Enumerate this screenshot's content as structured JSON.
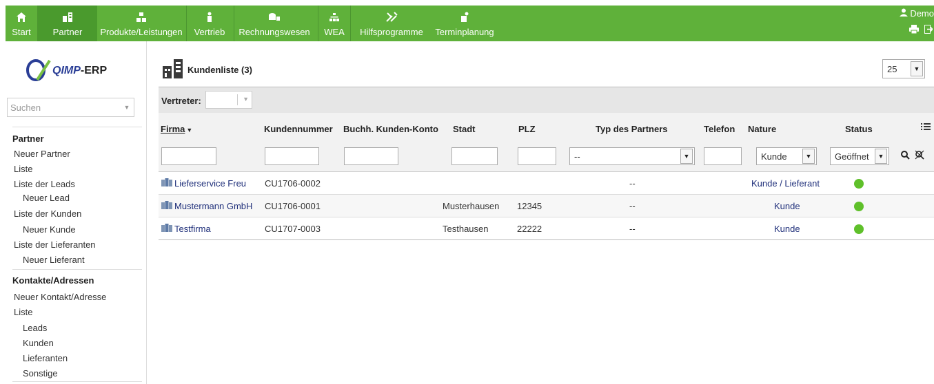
{
  "topbar": {
    "menu": [
      {
        "label": "Start",
        "icon": "home-icon"
      },
      {
        "label": "Partner",
        "icon": "partner-icon",
        "active": true
      },
      {
        "label": "Produkte/Leistungen",
        "icon": "products-icon"
      },
      {
        "label": "Vertrieb",
        "icon": "sales-icon"
      },
      {
        "label": "Rechnungswesen",
        "icon": "accounting-icon"
      },
      {
        "label": "WEA",
        "icon": "wea-icon"
      },
      {
        "label": "Hilfsprogramme",
        "icon": "tools-icon"
      },
      {
        "label": "Terminplanung",
        "icon": "schedule-icon"
      }
    ],
    "user": "Demo",
    "accent": "#5fb13a"
  },
  "sidebar": {
    "logo": {
      "brand": "QIMP",
      "suffix": "-ERP"
    },
    "search_placeholder": "Suchen",
    "section1": {
      "title": "Partner",
      "items": [
        {
          "label": "Neuer Partner",
          "sub": false
        },
        {
          "label": "Liste",
          "sub": false
        },
        {
          "label": "Liste der Leads",
          "sub": false
        },
        {
          "label": "Neuer Lead",
          "sub": true
        },
        {
          "label": "Liste der Kunden",
          "sub": false
        },
        {
          "label": "Neuer Kunde",
          "sub": true
        },
        {
          "label": "Liste der Lieferanten",
          "sub": false
        },
        {
          "label": "Neuer Lieferant",
          "sub": true
        }
      ]
    },
    "section2": {
      "title": "Kontakte/Adressen",
      "items": [
        {
          "label": "Neuer Kontakt/Adresse",
          "sub": false
        },
        {
          "label": "Liste",
          "sub": false
        },
        {
          "label": "Leads",
          "sub": true
        },
        {
          "label": "Kunden",
          "sub": true
        },
        {
          "label": "Lieferanten",
          "sub": true
        },
        {
          "label": "Sonstige",
          "sub": true
        }
      ]
    }
  },
  "main": {
    "title": "Kundenliste (3)",
    "page_size": "25",
    "vertreter_label": "Vertreter:",
    "columns": {
      "firma": "Firma",
      "kundennummer": "Kundennummer",
      "konto": "Buchh. Kunden-Konto",
      "stadt": "Stadt",
      "plz": "PLZ",
      "typ": "Typ des Partners",
      "telefon": "Telefon",
      "nature": "Nature",
      "status": "Status"
    },
    "filters": {
      "typ": "--",
      "nature": "Kunde",
      "status": "Geöffnet"
    },
    "rows": [
      {
        "firma": "Lieferservice Freu",
        "kundennummer": "CU1706-0002",
        "konto": "",
        "stadt": "",
        "plz": "",
        "typ": "--",
        "telefon": "",
        "nature": "Kunde / Lieferant",
        "status": "open"
      },
      {
        "firma": "Mustermann GmbH",
        "kundennummer": "CU1706-0001",
        "konto": "",
        "stadt": "Musterhausen",
        "plz": "12345",
        "typ": "--",
        "telefon": "",
        "nature": "Kunde",
        "status": "open"
      },
      {
        "firma": "Testfirma",
        "kundennummer": "CU1707-0003",
        "konto": "",
        "stadt": "Testhausen",
        "plz": "22222",
        "typ": "--",
        "telefon": "",
        "nature": "Kunde",
        "status": "open"
      }
    ],
    "status_color": "#5fc02a"
  }
}
